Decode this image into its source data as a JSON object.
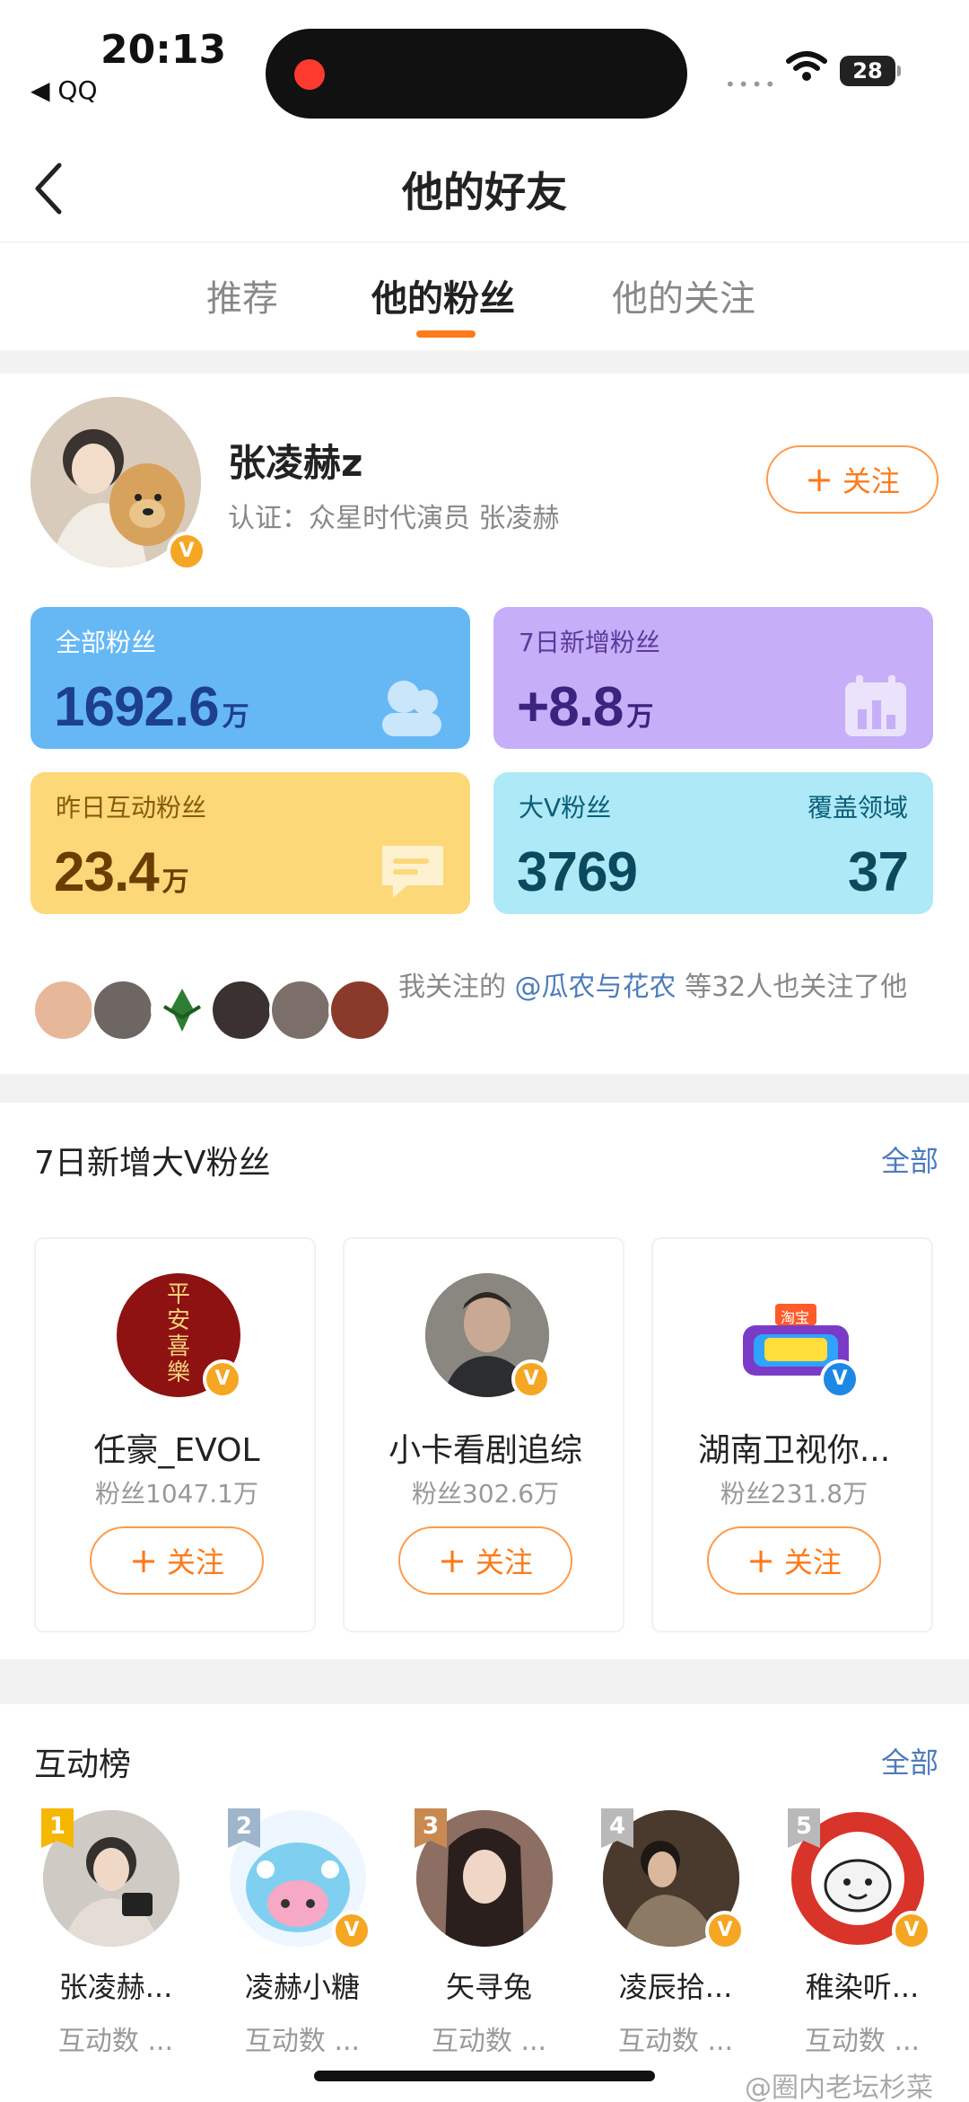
{
  "status_bar": {
    "time": "20:13",
    "back_app": "◀ QQ",
    "signal": "••••",
    "battery": "28"
  },
  "nav": {
    "title": "他的好友"
  },
  "tabs": [
    {
      "label": "推荐",
      "active": false
    },
    {
      "label": "他的粉丝",
      "active": true
    },
    {
      "label": "他的关注",
      "active": false
    }
  ],
  "profile": {
    "name": "张凌赫z",
    "verify": "认证：众星时代演员 张凌赫",
    "follow_label": "关注"
  },
  "stats": {
    "all_fans_label": "全部粉丝",
    "all_fans_value": "1692.6",
    "all_fans_unit": "万",
    "new_fans_label": "7日新增粉丝",
    "new_fans_value": "+8.8",
    "new_fans_unit": "万",
    "interact_label": "昨日互动粉丝",
    "interact_value": "23.4",
    "interact_unit": "万",
    "bigv_label": "大V粉丝",
    "bigv_value": "3769",
    "domain_label": "覆盖领域",
    "domain_value": "37"
  },
  "mutual": {
    "prefix": "我关注的 ",
    "link": "@瓜农与花农",
    "suffix": " 等32人也关注了他"
  },
  "bigv_section": {
    "title": "7日新增大V粉丝",
    "all_label": "全部",
    "cards": [
      {
        "name": "任豪_EVOL",
        "fans": "粉丝1047.1万",
        "follow": "关注",
        "avatar_text": "平安喜樂"
      },
      {
        "name": "小卡看剧追综",
        "fans": "粉丝302.6万",
        "follow": "关注"
      },
      {
        "name": "湖南卫视你...",
        "fans": "粉丝231.8万",
        "follow": "关注",
        "avatar_text": "淘宝"
      }
    ]
  },
  "rank_section": {
    "title": "互动榜",
    "all_label": "全部",
    "items": [
      {
        "rank": "1",
        "name": "张凌赫...",
        "sub": "互动数 ..."
      },
      {
        "rank": "2",
        "name": "凌赫小糖",
        "sub": "互动数 ..."
      },
      {
        "rank": "3",
        "name": "矢寻兔",
        "sub": "互动数 ..."
      },
      {
        "rank": "4",
        "name": "凌辰拾...",
        "sub": "互动数 ..."
      },
      {
        "rank": "5",
        "name": "稚染听...",
        "sub": "互动数 ..."
      }
    ]
  },
  "watermark": "@圈内老坛杉菜",
  "colors": {
    "accent": "#ff7a1a",
    "link": "#4e7bbd",
    "card_blue": "#66b8f5",
    "card_purple": "#c7aef8",
    "card_yellow": "#fcd879",
    "card_cyan": "#aee9f7"
  }
}
